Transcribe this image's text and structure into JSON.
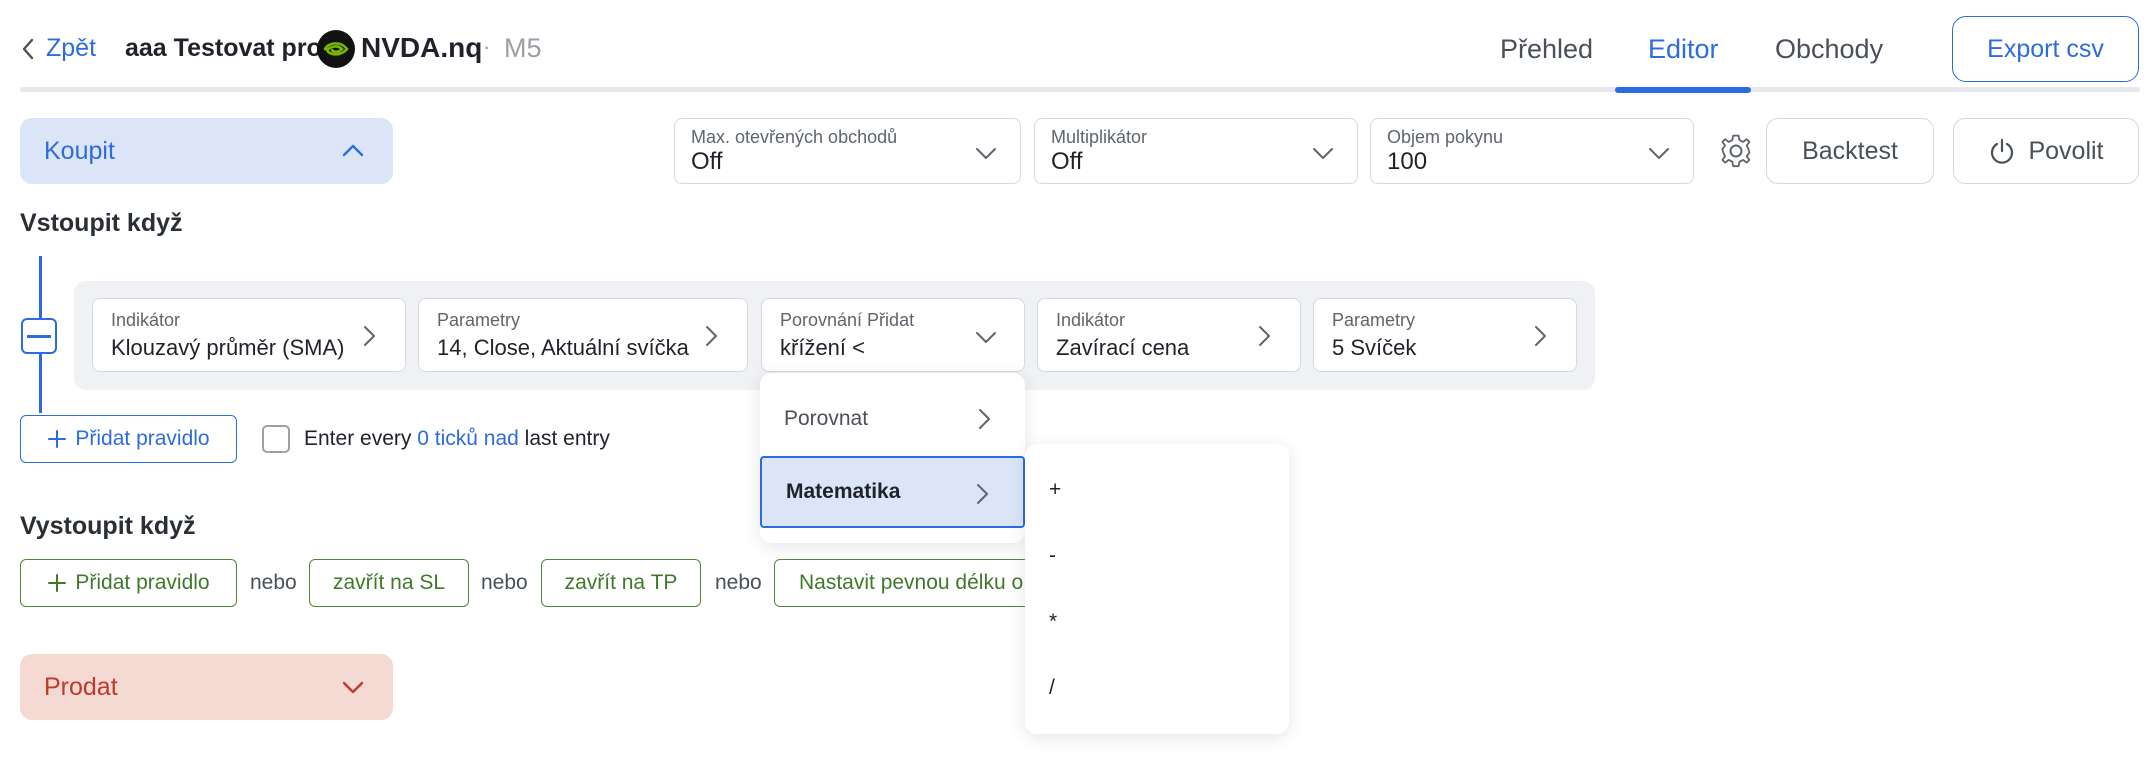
{
  "header": {
    "back_label": "Zpět",
    "title": "aaa Testovat pro",
    "symbol": "NVDA.nq",
    "separator": "·",
    "timeframe": "M5",
    "tabs": [
      {
        "label": "Přehled",
        "active": false
      },
      {
        "label": "Editor",
        "active": true
      },
      {
        "label": "Obchody",
        "active": false
      }
    ],
    "export_label": "Export csv"
  },
  "buy_section": {
    "label": "Koupit",
    "expanded": true
  },
  "sell_section": {
    "label": "Prodat",
    "expanded": false
  },
  "toolbar": {
    "max_trades": {
      "label": "Max. otevřených obchodů",
      "value": "Off"
    },
    "multiplier": {
      "label": "Multiplikátor",
      "value": "Off"
    },
    "order_volume": {
      "label": "Objem pokynu",
      "value": "100"
    },
    "backtest_label": "Backtest",
    "enable_label": "Povolit"
  },
  "entry": {
    "heading": "Vstoupit když",
    "rule": [
      {
        "label": "Indikátor",
        "value": "Klouzavý průměr (SMA)"
      },
      {
        "label": "Parametry",
        "value": "14, Close, Aktuální svíčka"
      },
      {
        "label": "Porovnání Přidat",
        "value": "křížení <"
      },
      {
        "label": "Indikátor",
        "value": "Zavírací cena"
      },
      {
        "label": "Parametry",
        "value": "5 Svíček"
      }
    ],
    "add_rule_label": "Přidat pravidlo",
    "enter_every_prefix": "Enter every",
    "enter_every_link": "0 ticků nad",
    "enter_every_suffix": "last entry",
    "enter_every_checked": false
  },
  "exit": {
    "heading": "Vystoupit když",
    "add_rule_label": "Přidat pravidlo",
    "or_label": "nebo",
    "close_sl_label": "zavřít na SL",
    "close_tp_label": "zavřít na TP",
    "fixed_length_label": "Nastavit pevnou délku o"
  },
  "compare_menu": {
    "items": [
      {
        "label": "Porovnat",
        "highlighted": false
      },
      {
        "label": "Matematika",
        "highlighted": true
      }
    ]
  },
  "math_menu": {
    "operators": [
      "+",
      "-",
      "*",
      "/"
    ]
  },
  "colors": {
    "accent": "#2d6cdf",
    "buy_bg": "#dbe5f7",
    "sell_bg": "#f5d9d3",
    "sell_text": "#c0392b",
    "exit_green": "#3f7a2b"
  },
  "icons": {
    "back": "chevron-left-icon",
    "logo": "nvidia-logo-icon",
    "settings": "gear-icon",
    "power": "power-icon"
  }
}
